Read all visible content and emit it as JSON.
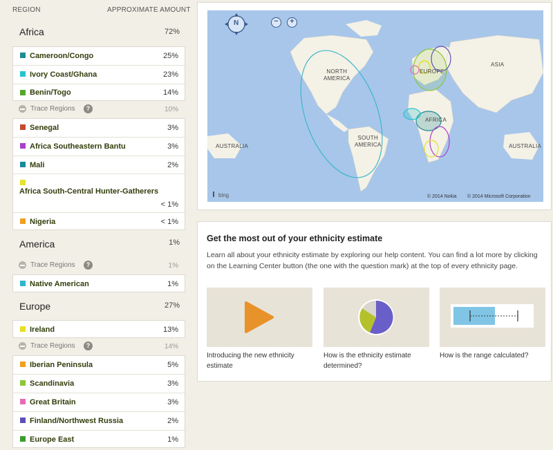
{
  "header": {
    "region_label": "REGION",
    "amount_label": "APPROXIMATE AMOUNT"
  },
  "regions": [
    {
      "name": "Africa",
      "pct": "72%",
      "trace": {
        "label": "Trace Regions",
        "pct": "10%"
      },
      "items": [
        {
          "label": "Cameroon/Congo",
          "pct": "25%",
          "color": "#1e8c92"
        },
        {
          "label": "Ivory Coast/Ghana",
          "pct": "23%",
          "color": "#25c4cf"
        },
        {
          "label": "Benin/Togo",
          "pct": "14%",
          "color": "#55a82c"
        }
      ],
      "trace_items": [
        {
          "label": "Senegal",
          "pct": "3%",
          "color": "#c44a2e"
        },
        {
          "label": "Africa Southeastern Bantu",
          "pct": "3%",
          "color": "#a841c8"
        },
        {
          "label": "Mali",
          "pct": "2%",
          "color": "#1a8a9a"
        },
        {
          "label": "Africa South-Central Hunter-Gatherers",
          "pct": "< 1%",
          "color": "#e6e32a"
        },
        {
          "label": "Nigeria",
          "pct": "< 1%",
          "color": "#f2a020"
        }
      ]
    },
    {
      "name": "America",
      "pct": "1%",
      "trace": {
        "label": "Trace Regions",
        "pct": "1%"
      },
      "trace_items": [
        {
          "label": "Native American",
          "pct": "1%",
          "color": "#2eb6c9"
        }
      ]
    },
    {
      "name": "Europe",
      "pct": "27%",
      "trace": {
        "label": "Trace Regions",
        "pct": "14%"
      },
      "items": [
        {
          "label": "Ireland",
          "pct": "13%",
          "color": "#e6df22"
        }
      ],
      "trace_items": [
        {
          "label": "Iberian Peninsula",
          "pct": "5%",
          "color": "#f2a020"
        },
        {
          "label": "Scandinavia",
          "pct": "3%",
          "color": "#8bc63a"
        },
        {
          "label": "Great Britain",
          "pct": "3%",
          "color": "#e46cb6"
        },
        {
          "label": "Finland/Northwest Russia",
          "pct": "2%",
          "color": "#5c50b8"
        },
        {
          "label": "Europe East",
          "pct": "1%",
          "color": "#3a9d2a"
        }
      ]
    }
  ],
  "trace_help": "?",
  "map": {
    "compass": "N",
    "zoom_out": "−",
    "zoom_in": "+",
    "labels": {
      "north_america": "NORTH\nAMERICA",
      "europe": "EUROPE",
      "asia": "ASIA",
      "africa": "AFRICA",
      "south_america": "SOUTH\nAMERICA",
      "australia_left": "AUSTRALIA",
      "australia_right": "AUSTRALIA"
    },
    "bing": "bing",
    "copyright_nokia": "© 2014 Nokia",
    "copyright_ms": "© 2014 Microsoft Corporation",
    "colors": {
      "ocean": "#a7c6ea",
      "land": "#f4f1e6"
    }
  },
  "help": {
    "title": "Get the most out of your ethnicity estimate",
    "body": "Learn all about your ethnicity estimate by exploring our help content. You can find a lot more by clicking on the Learning Center button (the one with the question mark) at the top of every ethnicity page.",
    "tiles": [
      {
        "caption": "Introducing the new ethnicity estimate",
        "icon": "play-icon"
      },
      {
        "caption": "How is the ethnicity estimate determined?",
        "icon": "pie-icon"
      },
      {
        "caption": "How is the range calculated?",
        "icon": "range-bar-icon"
      }
    ]
  }
}
